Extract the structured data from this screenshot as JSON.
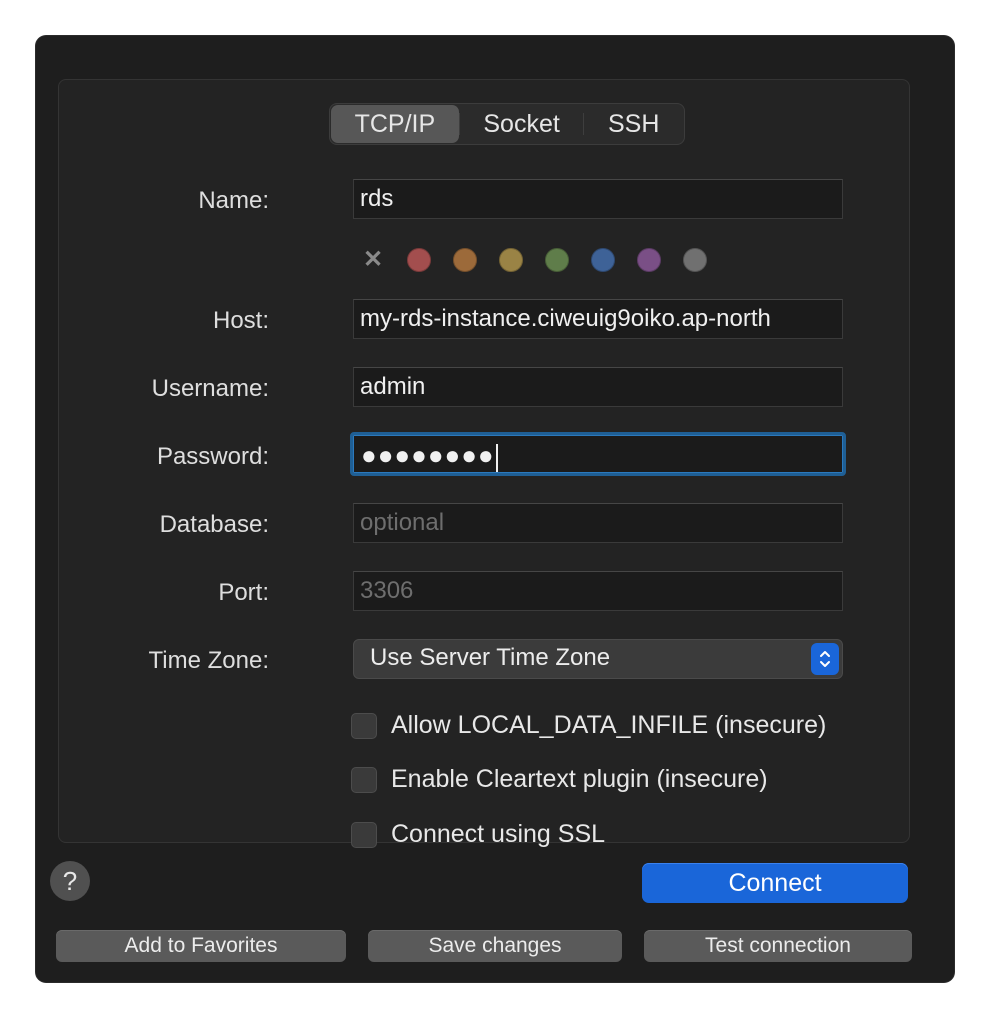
{
  "tabs": [
    {
      "label": "TCP/IP",
      "active": true
    },
    {
      "label": "Socket",
      "active": false
    },
    {
      "label": "SSH",
      "active": false
    }
  ],
  "form": {
    "name_label": "Name:",
    "name_value": "rds",
    "host_label": "Host:",
    "host_value": "my-rds-instance.ciweuig9oiko.ap-north",
    "username_label": "Username:",
    "username_value": "admin",
    "password_label": "Password:",
    "password_value": "●●●●●●●●",
    "database_label": "Database:",
    "database_placeholder": "optional",
    "port_label": "Port:",
    "port_placeholder": "3306",
    "timezone_label": "Time Zone:",
    "timezone_value": "Use Server Time Zone"
  },
  "color_tags": [
    {
      "name": "none",
      "color": "#8a8a8a"
    },
    {
      "name": "red",
      "color": "#a34e4e"
    },
    {
      "name": "orange",
      "color": "#9c6a3a"
    },
    {
      "name": "yellow",
      "color": "#9a8345"
    },
    {
      "name": "green",
      "color": "#5f7d4a"
    },
    {
      "name": "blue",
      "color": "#3e6297"
    },
    {
      "name": "purple",
      "color": "#7a4f86"
    },
    {
      "name": "gray",
      "color": "#707070"
    }
  ],
  "checkboxes": [
    {
      "label": "Allow LOCAL_DATA_INFILE (insecure)",
      "checked": false
    },
    {
      "label": "Enable Cleartext plugin (insecure)",
      "checked": false
    },
    {
      "label": "Connect using SSL",
      "checked": false
    }
  ],
  "buttons": {
    "help": "?",
    "connect": "Connect",
    "add_favorites": "Add to Favorites",
    "save_changes": "Save changes",
    "test_connection": "Test connection"
  },
  "colors": {
    "accent": "#1a66d9",
    "focus_ring": "#1f5f95",
    "window_bg": "#1e1e1e"
  }
}
